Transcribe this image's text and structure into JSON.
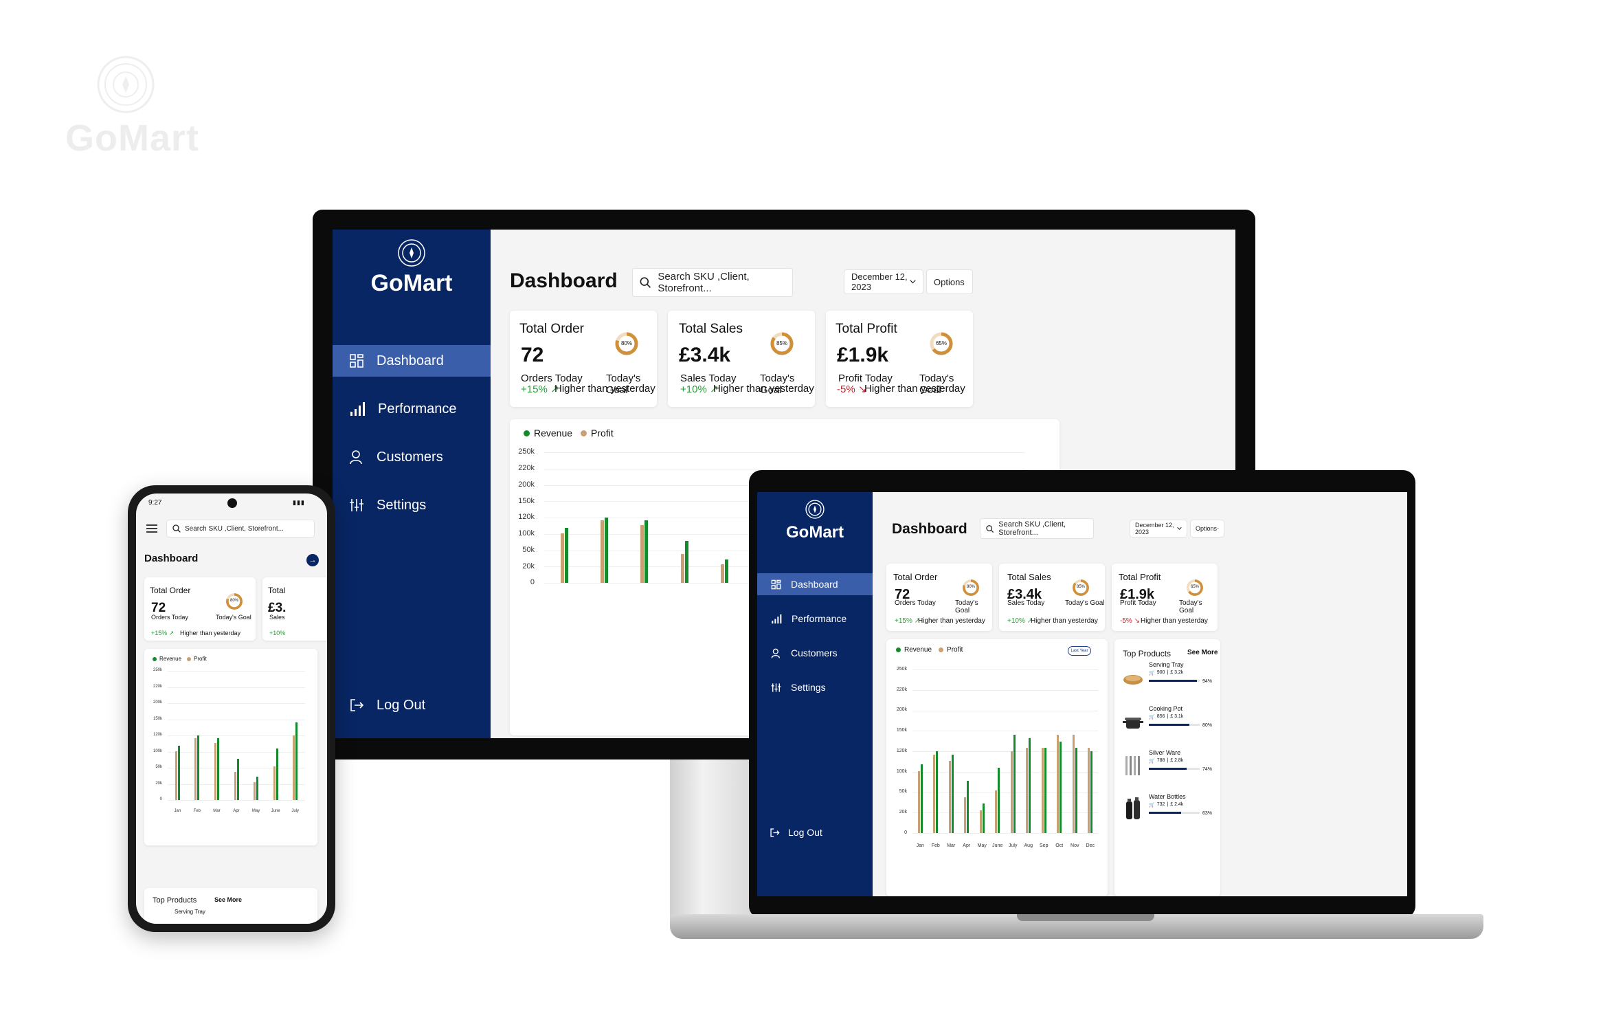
{
  "brand": {
    "name": "GoMart"
  },
  "nav": {
    "dashboard": "Dashboard",
    "performance": "Performance",
    "customers": "Customers",
    "settings": "Settings",
    "logout": "Log Out"
  },
  "header": {
    "title": "Dashboard",
    "search_placeholder": "Search SKU ,Client, Storefront...",
    "date": "December 12, 2023",
    "options": "Options",
    "last_year": "Last Year"
  },
  "kpis": {
    "order": {
      "title": "Total Order",
      "value": "72",
      "sub": "Orders Today",
      "goal_pct": "80%",
      "goal_label": "Today's Goal",
      "change": "+15%",
      "note": "Higher than yesterday",
      "goal": 0.8
    },
    "sales": {
      "title": "Total Sales",
      "value": "£3.4k",
      "sub": "Sales Today",
      "goal_pct": "85%",
      "goal_label": "Today's Goal",
      "change": "+10%",
      "note": "Higher than yesterday",
      "goal": 0.85
    },
    "profit": {
      "title": "Total Profit",
      "value": "£1.9k",
      "sub": "Profit Today",
      "goal_pct": "65%",
      "goal_label": "Today's Goal",
      "change": "-5%",
      "note": "Higher than yesterday",
      "goal": 0.65
    }
  },
  "legend": {
    "revenue": "Revenue",
    "profit": "Profit"
  },
  "colors": {
    "navy": "#082664",
    "revenue": "#138a2b",
    "profit": "#c9a073",
    "ring": "#d0903a",
    "up": "#2a9a3a",
    "down": "#c8202c"
  },
  "chart_data": {
    "type": "bar",
    "categories": [
      "Jan",
      "Feb",
      "Mar",
      "Apr",
      "May",
      "June",
      "July",
      "Aug",
      "Sep",
      "Oct",
      "Nov",
      "Dec"
    ],
    "series": [
      {
        "name": "Revenue",
        "values": [
          105000,
          125000,
          120000,
          80000,
          45000,
          100000,
          150000,
          145000,
          130000,
          140000,
          130000,
          125000
        ]
      },
      {
        "name": "Profit",
        "values": [
          95000,
          120000,
          110000,
          55000,
          35000,
          65000,
          125000,
          130000,
          130000,
          150000,
          150000,
          130000
        ]
      }
    ],
    "y_ticks": [
      "250k",
      "220k",
      "200k",
      "150k",
      "120k",
      "100k",
      "50k",
      "20k",
      "0"
    ],
    "ylim": [
      0,
      250000
    ]
  },
  "top_products": {
    "title": "Top Products",
    "see_more": "See More",
    "items": [
      {
        "name": "Serving Tray",
        "qty": "900",
        "amount": "£ 3.2k",
        "pct": "94%",
        "frac": 0.94
      },
      {
        "name": "Cooking Pot",
        "qty": "856",
        "amount": "£ 3.1k",
        "pct": "80%",
        "frac": 0.8
      },
      {
        "name": "Silver Ware",
        "qty": "788",
        "amount": "£ 2.8k",
        "pct": "74%",
        "frac": 0.74
      },
      {
        "name": "Water Bottles",
        "qty": "732",
        "amount": "£ 2.4k",
        "pct": "63%",
        "frac": 0.63
      }
    ]
  },
  "phone": {
    "time": "9:27",
    "title": "Dashboard",
    "search_placeholder": "Search SKU ,Client, Storefront...",
    "partial_title": "Total",
    "partial_value": "£3.",
    "partial_sub": "Sales",
    "partial_change": "+10%",
    "top_first": "Serving Tray"
  }
}
